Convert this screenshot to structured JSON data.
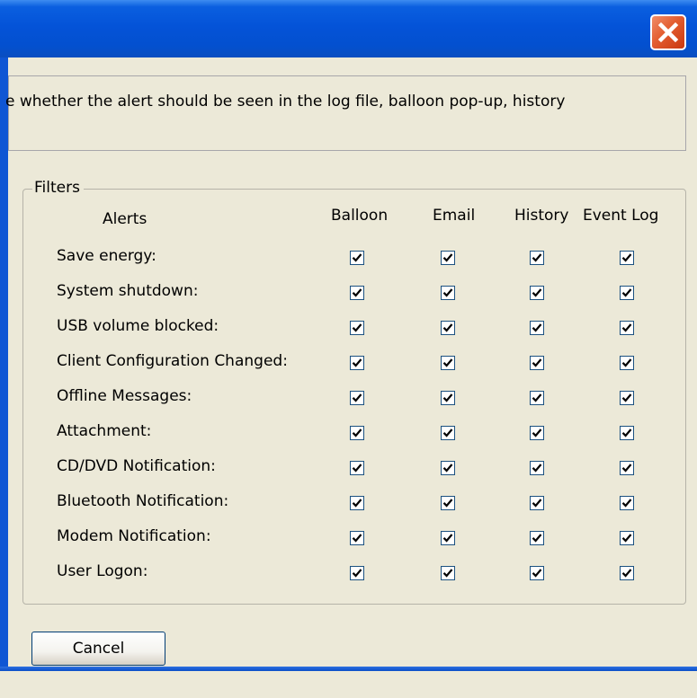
{
  "window": {
    "close_icon": "close-x-icon",
    "close_color": "#e35d30",
    "titlebar_color": "#0453d8"
  },
  "description": {
    "text": "e whether the alert should be seen in the log file, balloon pop-up, history"
  },
  "filters": {
    "legend": "Filters",
    "column_headers": {
      "alerts": "Alerts",
      "balloon": "Balloon",
      "email": "Email",
      "history": "History",
      "event_log": "Event Log"
    },
    "rows": [
      {
        "label": "Save energy:",
        "balloon": true,
        "email": true,
        "history": true,
        "event_log": true
      },
      {
        "label": "System shutdown:",
        "balloon": true,
        "email": true,
        "history": true,
        "event_log": true
      },
      {
        "label": "USB volume blocked:",
        "balloon": true,
        "email": true,
        "history": true,
        "event_log": true
      },
      {
        "label": "Client Configuration Changed:",
        "balloon": true,
        "email": true,
        "history": true,
        "event_log": true
      },
      {
        "label": "Offline Messages:",
        "balloon": true,
        "email": true,
        "history": true,
        "event_log": true
      },
      {
        "label": "Attachment:",
        "balloon": true,
        "email": true,
        "history": true,
        "event_log": true
      },
      {
        "label": "CD/DVD Notification:",
        "balloon": true,
        "email": true,
        "history": true,
        "event_log": true
      },
      {
        "label": "Bluetooth Notification:",
        "balloon": true,
        "email": true,
        "history": true,
        "event_log": true
      },
      {
        "label": "Modem Notification:",
        "balloon": true,
        "email": true,
        "history": true,
        "event_log": true
      },
      {
        "label": "User Logon:",
        "balloon": true,
        "email": true,
        "history": true,
        "event_log": true
      }
    ]
  },
  "buttons": {
    "cancel_label": "Cancel"
  }
}
